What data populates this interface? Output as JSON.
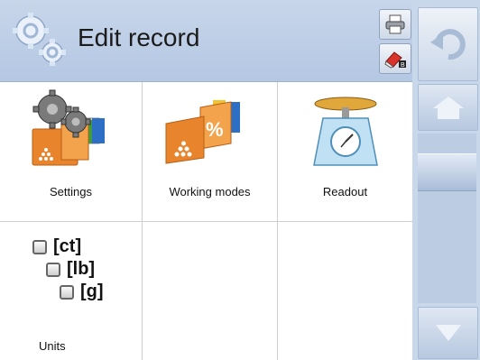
{
  "header": {
    "title": "Edit record",
    "icon": "gears-logo-icon",
    "buttons": [
      {
        "name": "print",
        "icon": "printer-icon"
      },
      {
        "name": "clear",
        "icon": "eraser-icon"
      }
    ]
  },
  "tiles": {
    "settings": {
      "label": "Settings",
      "icon": "settings-gears-icon"
    },
    "working_modes": {
      "label": "Working modes",
      "icon": "working-modes-icon"
    },
    "readout": {
      "label": "Readout",
      "icon": "scale-readout-icon"
    },
    "units": {
      "label": "Units",
      "items": [
        "[ct]",
        "[lb]",
        "[g]"
      ]
    }
  },
  "sidebar": {
    "back": {
      "icon": "undo-arrow-icon"
    },
    "home": {
      "icon": "home-icon"
    },
    "down": {
      "icon": "arrow-down-icon"
    }
  },
  "colors": {
    "header_bg": "#b9cbe4",
    "sidebar_bg": "#c9d7ea",
    "grid_line": "#cfcfcf",
    "accent_orange": "#e8842c"
  }
}
